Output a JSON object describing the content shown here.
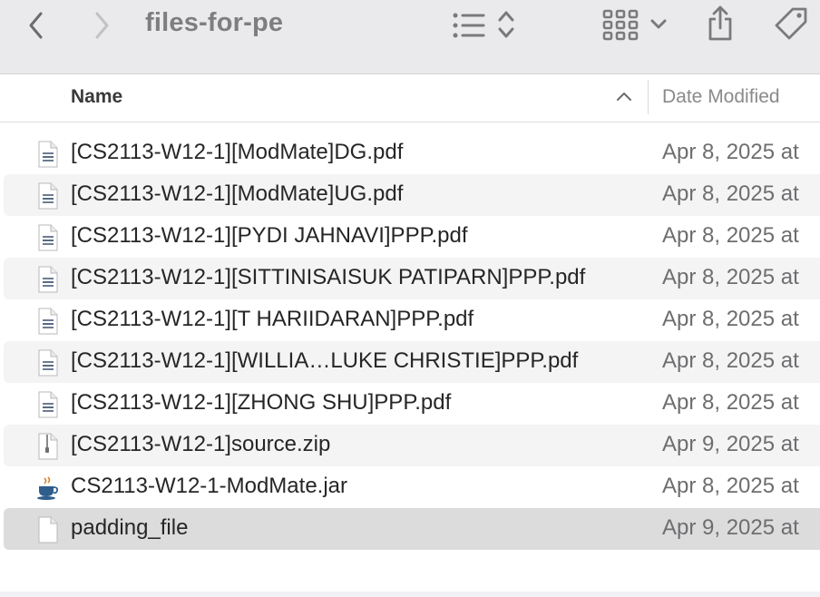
{
  "window": {
    "title": "files-for-pe"
  },
  "toolbar": {
    "icons": [
      "back-chevron-icon",
      "forward-chevron-icon",
      "list-view-icon",
      "sort-updown-icon",
      "grid-view-icon",
      "chevron-down-icon",
      "share-icon",
      "tag-icon"
    ]
  },
  "columns": {
    "name": "Name",
    "date_modified": "Date Modified",
    "sort_direction": "ascending"
  },
  "files": [
    {
      "name": "[CS2113-W12-1][ModMate]DG.pdf",
      "date": "Apr 8, 2025 at",
      "type": "pdf"
    },
    {
      "name": "[CS2113-W12-1][ModMate]UG.pdf",
      "date": "Apr 8, 2025 at",
      "type": "pdf"
    },
    {
      "name": "[CS2113-W12-1][PYDI JAHNAVI]PPP.pdf",
      "date": "Apr 8, 2025 at",
      "type": "pdf"
    },
    {
      "name": "[CS2113-W12-1][SITTINISAISUK PATIPARN]PPP.pdf",
      "date": "Apr 8, 2025 at",
      "type": "pdf"
    },
    {
      "name": "[CS2113-W12-1][T HARIIDARAN]PPP.pdf",
      "date": "Apr 8, 2025 at",
      "type": "pdf"
    },
    {
      "name": "[CS2113-W12-1][WILLIA…LUKE CHRISTIE]PPP.pdf",
      "date": "Apr 8, 2025 at",
      "type": "pdf"
    },
    {
      "name": "[CS2113-W12-1][ZHONG SHU]PPP.pdf",
      "date": "Apr 8, 2025 at",
      "type": "pdf"
    },
    {
      "name": "[CS2113-W12-1]source.zip",
      "date": "Apr 9, 2025 at",
      "type": "zip"
    },
    {
      "name": "CS2113-W12-1-ModMate.jar",
      "date": "Apr 8, 2025 at",
      "type": "jar"
    },
    {
      "name": "padding_file",
      "date": "Apr 9, 2025 at",
      "type": "blank",
      "selected": true
    }
  ],
  "colors": {
    "toolbar_bg": "#eaeaec",
    "row_alt": "#f4f4f5",
    "row_selected": "#dcdcdd"
  }
}
